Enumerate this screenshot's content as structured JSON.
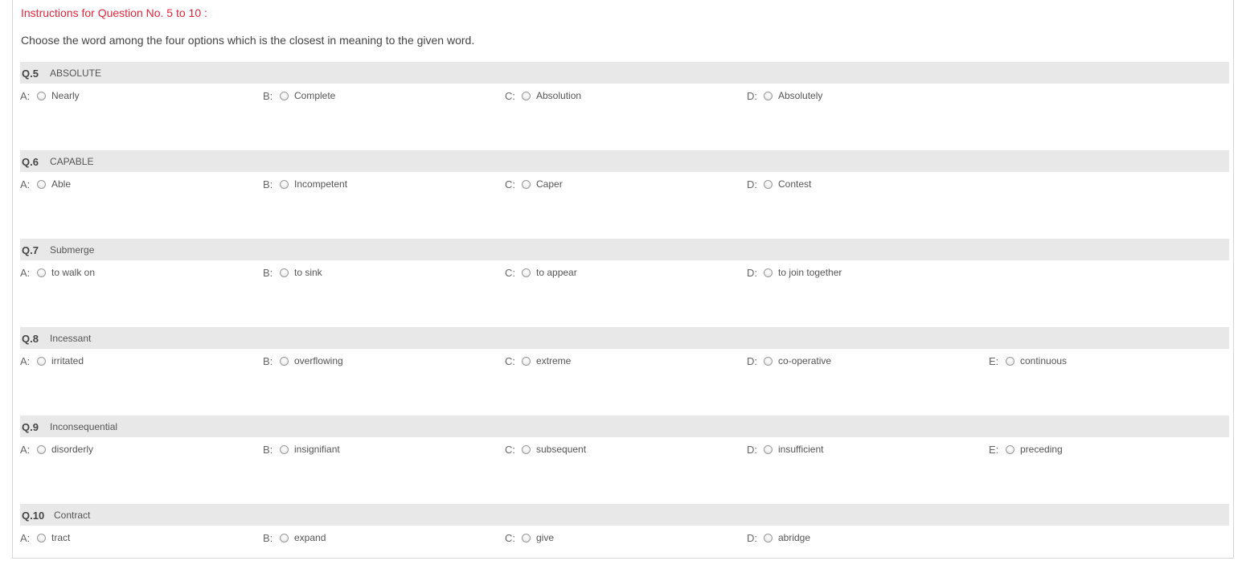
{
  "instructions": {
    "title": "Instructions for Question No. 5 to 10 :",
    "text": "Choose the word among the four options which is the closest in meaning to the given word."
  },
  "questions": [
    {
      "number": "Q.5",
      "word": "ABSOLUTE",
      "options": [
        {
          "letter": "A:",
          "text": "Nearly"
        },
        {
          "letter": "B:",
          "text": "Complete"
        },
        {
          "letter": "C:",
          "text": "Absolution"
        },
        {
          "letter": "D:",
          "text": "Absolutely"
        }
      ]
    },
    {
      "number": "Q.6",
      "word": "CAPABLE",
      "options": [
        {
          "letter": "A:",
          "text": "Able"
        },
        {
          "letter": "B:",
          "text": "Incompetent"
        },
        {
          "letter": "C:",
          "text": "Caper"
        },
        {
          "letter": "D:",
          "text": "Contest"
        }
      ]
    },
    {
      "number": "Q.7",
      "word": "Submerge",
      "options": [
        {
          "letter": "A:",
          "text": "to walk on"
        },
        {
          "letter": "B:",
          "text": "to sink"
        },
        {
          "letter": "C:",
          "text": "to appear"
        },
        {
          "letter": "D:",
          "text": "to join together"
        }
      ]
    },
    {
      "number": "Q.8",
      "word": "Incessant",
      "options": [
        {
          "letter": "A:",
          "text": "irritated"
        },
        {
          "letter": "B:",
          "text": "overflowing"
        },
        {
          "letter": "C:",
          "text": "extreme"
        },
        {
          "letter": "D:",
          "text": "co-operative"
        },
        {
          "letter": "E:",
          "text": "continuous"
        }
      ]
    },
    {
      "number": "Q.9",
      "word": "Inconsequential",
      "options": [
        {
          "letter": "A:",
          "text": "disorderly"
        },
        {
          "letter": "B:",
          "text": "insignifiant"
        },
        {
          "letter": "C:",
          "text": "subsequent"
        },
        {
          "letter": "D:",
          "text": "insufficient"
        },
        {
          "letter": "E:",
          "text": "preceding"
        }
      ]
    },
    {
      "number": "Q.10",
      "word": "Contract",
      "options": [
        {
          "letter": "A:",
          "text": "tract"
        },
        {
          "letter": "B:",
          "text": "expand"
        },
        {
          "letter": "C:",
          "text": "give"
        },
        {
          "letter": "D:",
          "text": "abridge"
        }
      ]
    }
  ]
}
